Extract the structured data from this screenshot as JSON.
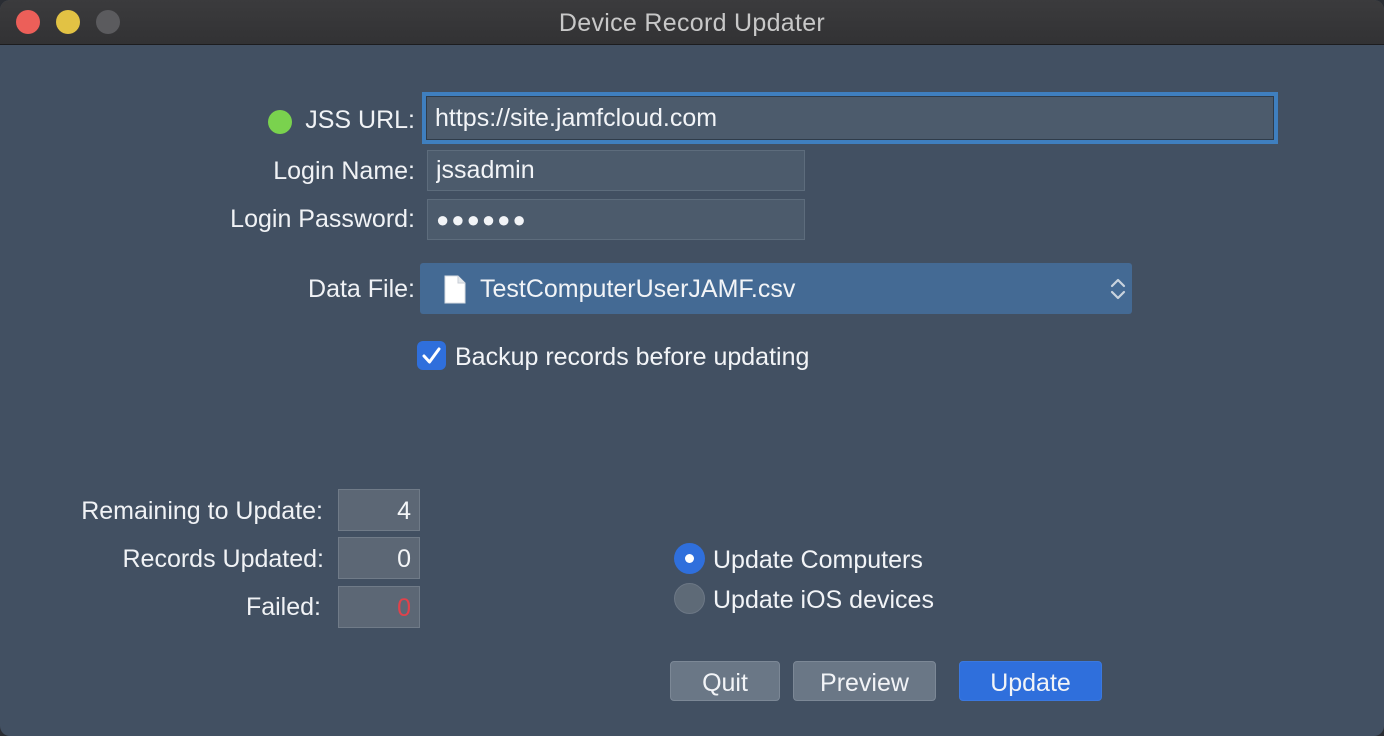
{
  "window": {
    "title": "Device Record Updater"
  },
  "connection": {
    "status_color": "#7ad24e",
    "jss_url_label": "JSS URL:",
    "jss_url_value": "https://site.jamfcloud.com",
    "login_name_label": "Login Name:",
    "login_name_value": "jssadmin",
    "login_password_label": "Login Password:",
    "login_password_value": "●●●●●●"
  },
  "data_file": {
    "label": "Data File:",
    "selected": "TestComputerUserJAMF.csv",
    "icon": "document-icon"
  },
  "backup": {
    "label": "Backup records before updating",
    "checked": true
  },
  "counts": {
    "remaining_label": "Remaining to Update:",
    "remaining_value": "4",
    "updated_label": "Records Updated:",
    "updated_value": "0",
    "failed_label": "Failed:",
    "failed_value": "0",
    "failed_color": "#e0424b"
  },
  "device_type": {
    "options": [
      {
        "label": "Update Computers",
        "selected": true
      },
      {
        "label": "Update iOS devices",
        "selected": false
      }
    ]
  },
  "buttons": {
    "quit": "Quit",
    "preview": "Preview",
    "update": "Update"
  }
}
